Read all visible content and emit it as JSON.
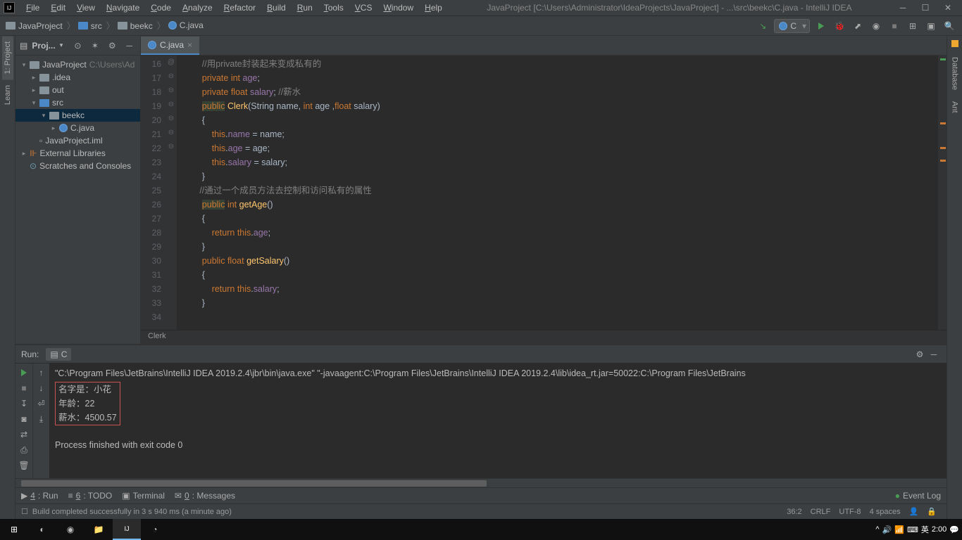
{
  "title_bar": {
    "app_logo": "IJ",
    "menu": [
      "File",
      "Edit",
      "View",
      "Navigate",
      "Code",
      "Analyze",
      "Refactor",
      "Build",
      "Run",
      "Tools",
      "VCS",
      "Window",
      "Help"
    ],
    "title": "JavaProject [C:\\Users\\Administrator\\IdeaProjects\\JavaProject] - ...\\src\\beekc\\C.java - IntelliJ IDEA"
  },
  "breadcrumbs": [
    {
      "icon": "folder",
      "label": "JavaProject"
    },
    {
      "icon": "folder-blue",
      "label": "src"
    },
    {
      "icon": "folder",
      "label": "beekc"
    },
    {
      "icon": "java",
      "label": "C.java"
    }
  ],
  "run_config": {
    "name": "C"
  },
  "left_tabs": [
    {
      "label": "1: Project",
      "active": true
    },
    {
      "label": "Learn",
      "active": false
    }
  ],
  "right_tabs": [
    {
      "label": "Database"
    },
    {
      "label": "Ant"
    }
  ],
  "project_panel": {
    "title": "Proj...",
    "tree": [
      {
        "indent": 0,
        "arrow": "▾",
        "icon": "folder",
        "label": "JavaProject",
        "suffix": " C:\\Users\\Ad"
      },
      {
        "indent": 1,
        "arrow": "▸",
        "icon": "folder",
        "label": ".idea"
      },
      {
        "indent": 1,
        "arrow": "▸",
        "icon": "folder",
        "label": "out"
      },
      {
        "indent": 1,
        "arrow": "▾",
        "icon": "folder-blue",
        "label": "src"
      },
      {
        "indent": 2,
        "arrow": "▾",
        "icon": "folder",
        "label": "beekc",
        "selected": true
      },
      {
        "indent": 3,
        "arrow": "▸",
        "icon": "java",
        "label": "C.java"
      },
      {
        "indent": 1,
        "arrow": "",
        "icon": "file",
        "label": "JavaProject.iml"
      },
      {
        "indent": 0,
        "arrow": "▸",
        "icon": "lib",
        "label": "External Libraries"
      },
      {
        "indent": 0,
        "arrow": "",
        "icon": "scratch",
        "label": "Scratches and Consoles"
      }
    ]
  },
  "editor": {
    "tab": "C.java",
    "breadcrumb": "Clerk",
    "first_line": 16,
    "gutter_marks": {
      "16": "",
      "17": "",
      "18": "",
      "19": "",
      "20": "@",
      "21": "⊖",
      "22": "",
      "23": "",
      "24": "",
      "25": "⊖",
      "26": "",
      "27": "⊖",
      "28": "",
      "29": "",
      "30": "⊖",
      "31": "⊖",
      "32": "",
      "33": "",
      "34": "⊖"
    },
    "lines": [
      {
        "n": 16,
        "html": "        <span class='cmt'>//用private封装起来变成私有的</span>"
      },
      {
        "n": 17,
        "html": "        <span class='kw'>private</span> <span class='kw'>int</span> <span class='fld'>age</span>;"
      },
      {
        "n": 18,
        "html": "        <span class='kw'>private</span> <span class='kw'>float</span> <span class='fld'>salary</span>; <span class='cmt'>//薪水</span>"
      },
      {
        "n": 19,
        "html": ""
      },
      {
        "n": 20,
        "html": "        <span class='kw-hl'>public</span> <span class='fn'>Clerk</span>(String name, <span class='kw'>int</span> age ,<span class='kw'>float</span> salary)"
      },
      {
        "n": 21,
        "html": "        {"
      },
      {
        "n": 22,
        "html": "            <span class='this'>this</span>.<span class='fld'>name</span> = name;"
      },
      {
        "n": 23,
        "html": "            <span class='this'>this</span>.<span class='fld'>age</span> = age;"
      },
      {
        "n": 24,
        "html": "            <span class='this'>this</span>.<span class='fld'>salary</span> = salary;"
      },
      {
        "n": 25,
        "html": "        }"
      },
      {
        "n": 26,
        "html": "       <span class='cmt'>//通过一个成员方法去控制和访问私有的属性</span>"
      },
      {
        "n": 27,
        "html": "        <span class='kw-hl'>public</span> <span class='kw'>int</span> <span class='fn'>getAge</span>()"
      },
      {
        "n": 28,
        "html": "        {"
      },
      {
        "n": 29,
        "html": "            <span class='kw'>return</span> <span class='this'>this</span>.<span class='fld'>age</span>;"
      },
      {
        "n": 30,
        "html": "        }"
      },
      {
        "n": 31,
        "html": "        <span class='kw'>public</span> <span class='kw'>float</span> <span class='fn'>getSalary</span>()"
      },
      {
        "n": 32,
        "html": "        {"
      },
      {
        "n": 33,
        "html": "            <span class='kw'>return</span> <span class='this'>this</span>.<span class='fld'>salary</span>;"
      },
      {
        "n": 34,
        "html": "        }"
      }
    ]
  },
  "run_panel": {
    "title": "Run:",
    "config": "C",
    "cmd": "\"C:\\Program Files\\JetBrains\\IntelliJ IDEA 2019.2.4\\jbr\\bin\\java.exe\" \"-javaagent:C:\\Program Files\\JetBrains\\IntelliJ IDEA 2019.2.4\\lib\\idea_rt.jar=50022:C:\\Program Files\\JetBrains",
    "out_lines": [
      "名字是：小花",
      "年龄：22",
      "薪水：4500.57"
    ],
    "exit": "Process finished with exit code 0"
  },
  "bottom_tabs": [
    {
      "icon": "▶",
      "label": "4: Run",
      "u": "4"
    },
    {
      "icon": "≡",
      "label": "6: TODO",
      "u": "6"
    },
    {
      "icon": "▣",
      "label": "Terminal"
    },
    {
      "icon": "✉",
      "label": "0: Messages",
      "u": "0"
    }
  ],
  "event_log": "Event Log",
  "status": {
    "msg": "Build completed successfully in 3 s 940 ms (a minute ago)",
    "pos": "36:2",
    "eol": "CRLF",
    "enc": "UTF-8",
    "indent": "4 spaces"
  },
  "taskbar": {
    "time": "2:00",
    "ime": "英",
    "icons": [
      "win",
      "cortana",
      "chrome",
      "folder",
      "intellij",
      "term"
    ]
  }
}
